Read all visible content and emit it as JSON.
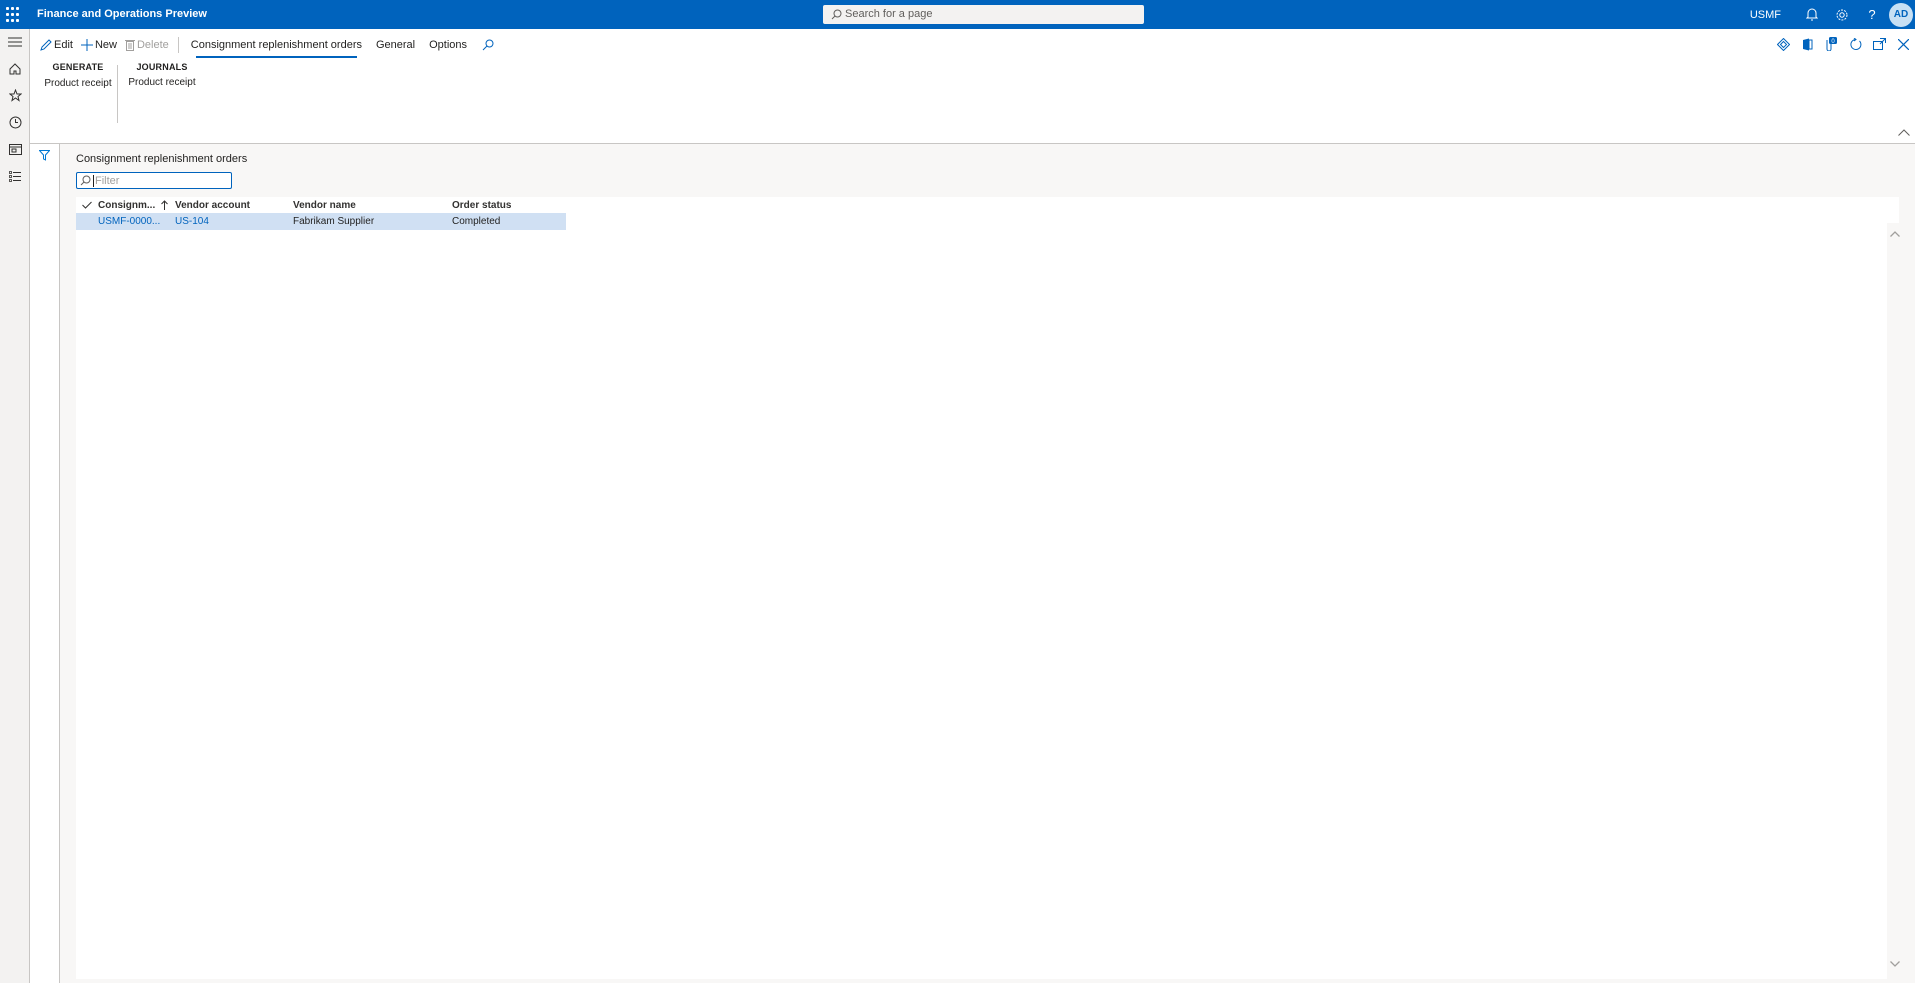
{
  "app": {
    "title": "Finance and Operations Preview",
    "search_placeholder": "Search for a page",
    "company": "USMF",
    "avatar_initials": "AD",
    "brand_color": "#0063bd"
  },
  "leftnav": {
    "items": [
      {
        "name": "menu",
        "icon": "hamburger-icon"
      },
      {
        "name": "home",
        "icon": "home-icon"
      },
      {
        "name": "favorites",
        "icon": "star-icon"
      },
      {
        "name": "recent",
        "icon": "clock-icon"
      },
      {
        "name": "workspaces",
        "icon": "workspace-icon"
      },
      {
        "name": "modules",
        "icon": "list-icon"
      }
    ]
  },
  "actionpane": {
    "edit_label": "Edit",
    "new_label": "New",
    "delete_label": "Delete",
    "tabs": [
      {
        "label": "Consignment replenishment orders",
        "active": true
      },
      {
        "label": "General",
        "active": false
      },
      {
        "label": "Options",
        "active": false
      }
    ],
    "groups": [
      {
        "header": "GENERATE",
        "items": [
          "Product receipt"
        ]
      },
      {
        "header": "JOURNALS",
        "items": [
          "Product receipt"
        ]
      }
    ],
    "right_tools": [
      "power-apps-icon",
      "office-icon",
      "attachments-icon",
      "refresh-icon",
      "open-new-window-icon",
      "close-icon"
    ],
    "attachments_count": "0"
  },
  "grid": {
    "title": "Consignment replenishment orders",
    "filter_placeholder": "Filter",
    "columns": [
      "Consignm...",
      "Vendor account",
      "Vendor name",
      "Order status"
    ],
    "rows": [
      {
        "id": "USMF-0000...",
        "vendor_account": "US-104",
        "vendor_name": "Fabrikam Supplier",
        "order_status": "Completed",
        "selected": true
      }
    ]
  }
}
